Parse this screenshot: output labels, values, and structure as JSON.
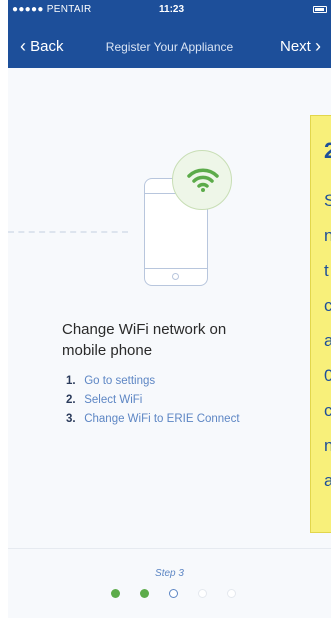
{
  "status_bar": {
    "carrier": "●●●●● PENTAIR",
    "wifi_icon": "wifi-icon",
    "time": "11:23",
    "battery_icon": "battery-icon"
  },
  "nav": {
    "back_label": "Back",
    "title": "Register Your Appliance",
    "next_label": "Next"
  },
  "illustration": {
    "phone_icon": "phone-icon",
    "wifi_icon": "wifi-icon",
    "accent_color": "#5cab4a"
  },
  "content": {
    "heading": "Change WiFi network on mobile phone",
    "steps": [
      {
        "num": "1.",
        "text": "Go to settings"
      },
      {
        "num": "2.",
        "text": "Select WiFi"
      },
      {
        "num": "3.",
        "text": "Change WiFi to ERIE Connect"
      }
    ]
  },
  "progress": {
    "label": "Step 3",
    "total_steps": 5,
    "current_step": 3
  },
  "overlay_note": {
    "number": "2",
    "lines": [
      "S",
      "n",
      "t",
      "c",
      "a",
      "0",
      "c",
      "n",
      "a"
    ]
  },
  "colors": {
    "nav_bar": "#1d4f9a",
    "link_blue": "#5d86c4",
    "done_green": "#5cab4a",
    "note_yellow": "#f8f07a"
  }
}
